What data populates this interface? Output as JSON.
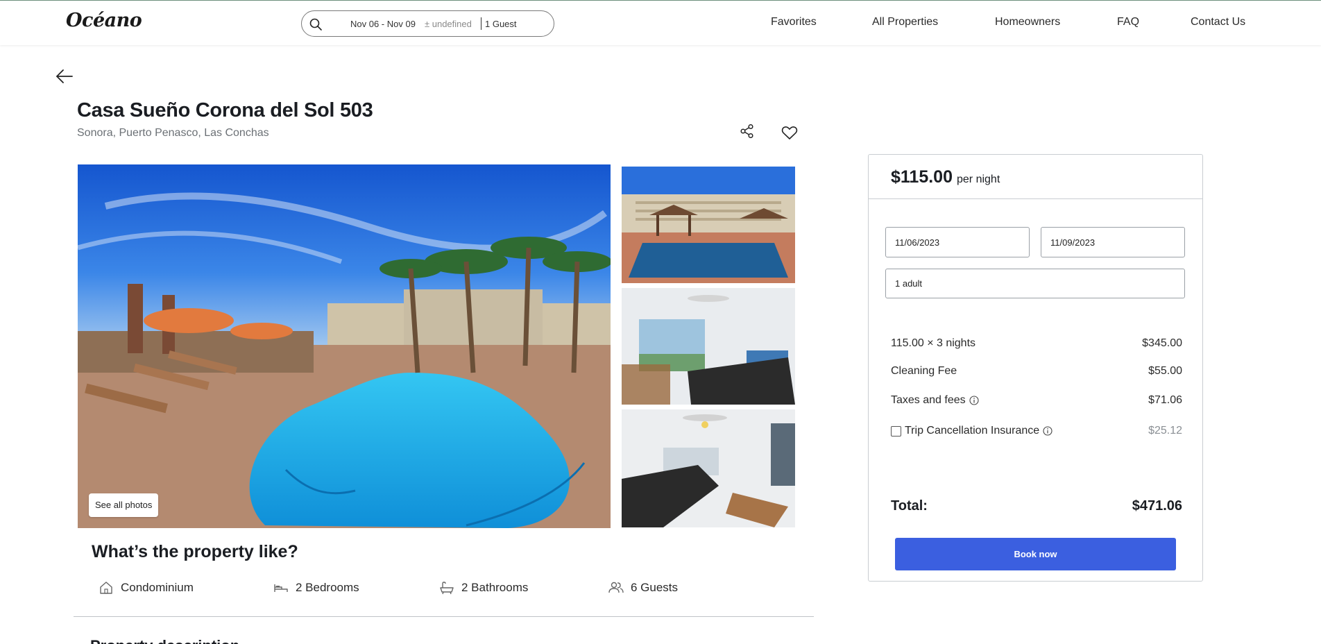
{
  "header": {
    "logo": "Océano",
    "search": {
      "dates": "Nov 06 - Nov 09",
      "flex": "± undefined",
      "guests": "1 Guest"
    },
    "nav": [
      "Favorites",
      "All Properties",
      "Homeowners",
      "FAQ",
      "Contact Us"
    ]
  },
  "listing": {
    "title": "Casa Sueño Corona del Sol 503",
    "location": "Sonora, Puerto Penasco, Las Conchas",
    "see_all_photos": "See all photos",
    "photos": [
      "pool-with-palm-trees",
      "pool-with-condo-building",
      "living-room-sofa",
      "living-room-sectional"
    ]
  },
  "property": {
    "heading": "What’s the property like?",
    "features": [
      {
        "icon": "house-icon",
        "label": "Condominium"
      },
      {
        "icon": "bed-icon",
        "label": "2 Bedrooms"
      },
      {
        "icon": "bathtub-icon",
        "label": "2 Bathrooms"
      },
      {
        "icon": "guests-icon",
        "label": "6 Guests"
      }
    ],
    "next_heading": "Property description"
  },
  "booking": {
    "price": "$115.00",
    "per_night": "per night",
    "checkin": "11/06/2023",
    "checkout": "11/09/2023",
    "guests": "1 adult",
    "lines": {
      "nights_label": "115.00 × 3 nights",
      "nights_value": "$345.00",
      "cleaning_label": "Cleaning Fee",
      "cleaning_value": "$55.00",
      "taxes_label": "Taxes and fees",
      "taxes_value": "$71.06",
      "insurance_label": "Trip Cancellation Insurance",
      "insurance_value": "$25.12",
      "insurance_checked": false
    },
    "total_label": "Total:",
    "total_value": "$471.06",
    "book_label": "Book now",
    "accent_color": "#3b5fe0"
  }
}
